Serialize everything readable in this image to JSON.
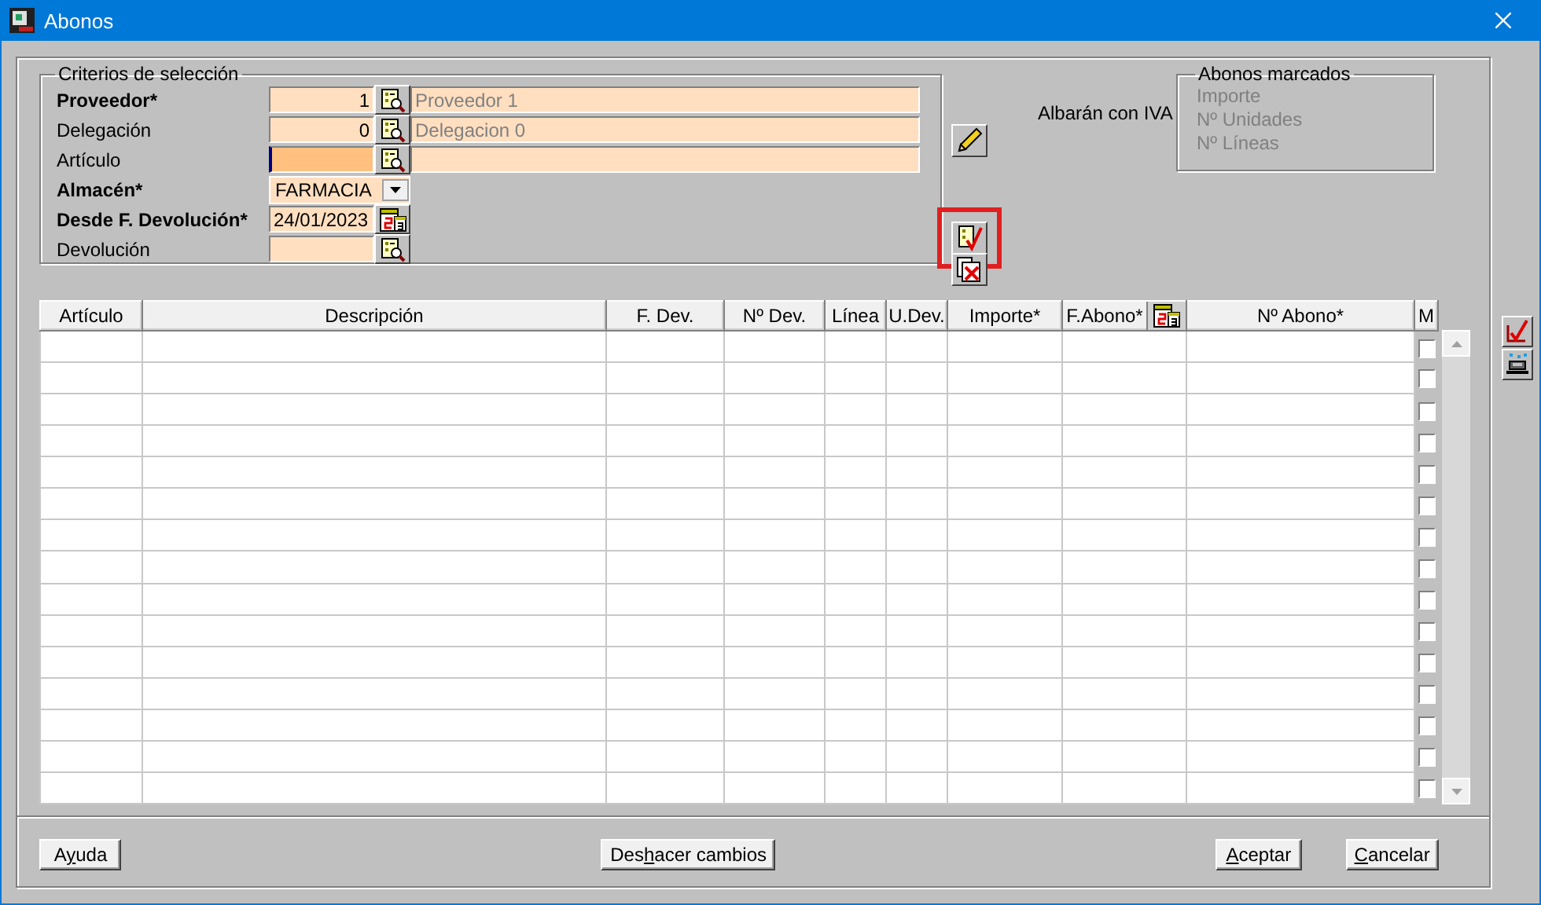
{
  "window": {
    "title": "Abonos"
  },
  "criteria": {
    "title": "Criterios de selección",
    "fields": [
      {
        "kind": "lookup",
        "label": "Proveedor*",
        "required": true,
        "value": "1",
        "focused": false,
        "description": "Proveedor 1"
      },
      {
        "kind": "lookup",
        "label": "Delegación",
        "required": false,
        "value": "0",
        "focused": false,
        "description": "Delegacion 0"
      },
      {
        "kind": "lookup",
        "label": "Artículo",
        "required": false,
        "focused": true
      },
      {
        "kind": "combo",
        "label": "Almacén*",
        "required": true,
        "value": "FARMACIA",
        "focused": false
      },
      {
        "kind": "date",
        "label": "Desde F. Devolución*",
        "required": true,
        "value": "24/01/2023",
        "focused": false
      },
      {
        "kind": "code",
        "label": "Devolución",
        "required": false,
        "focused": false
      }
    ]
  },
  "tools": [
    {
      "kind": "edit",
      "highlighted": false
    },
    {
      "kind": "mark",
      "highlighted": true
    },
    {
      "kind": "unmark",
      "highlighted": false
    }
  ],
  "iva_label": "Albarán con IVA",
  "marked": {
    "title": "Abonos marcados",
    "lines": [
      "Importe",
      "Nº Unidades",
      "Nº Líneas"
    ]
  },
  "table": {
    "columns": [
      {
        "label": "Artículo",
        "picker": false
      },
      {
        "label": "Descripción",
        "picker": false
      },
      {
        "label": "F. Dev.",
        "picker": false
      },
      {
        "label": "Nº Dev.",
        "picker": false
      },
      {
        "label": "Línea",
        "picker": false
      },
      {
        "label": "U.Dev.",
        "picker": false
      },
      {
        "label": "Importe*",
        "picker": false
      },
      {
        "label": "F.Abono*",
        "picker": true
      },
      {
        "label": "Nº Abono*",
        "picker": false
      },
      {
        "label": "M",
        "picker": false
      }
    ],
    "rows": [
      {
        "checked": false
      },
      {
        "checked": false
      },
      {
        "checked": false
      },
      {
        "checked": false
      },
      {
        "checked": false
      },
      {
        "checked": false
      },
      {
        "checked": false
      },
      {
        "checked": false
      },
      {
        "checked": false
      },
      {
        "checked": false
      },
      {
        "checked": false
      },
      {
        "checked": false
      },
      {
        "checked": false
      },
      {
        "checked": false
      },
      {
        "checked": false
      }
    ]
  },
  "side_tools": [
    {
      "kind": "tick"
    },
    {
      "kind": "print"
    }
  ],
  "buttons": [
    {
      "before": "A",
      "key": "y",
      "after": "uda"
    },
    {
      "before": "Des",
      "key": "h",
      "after": "acer cambios"
    },
    {
      "key": "A",
      "after": "ceptar"
    },
    {
      "key": "C",
      "after": "ancelar"
    }
  ]
}
